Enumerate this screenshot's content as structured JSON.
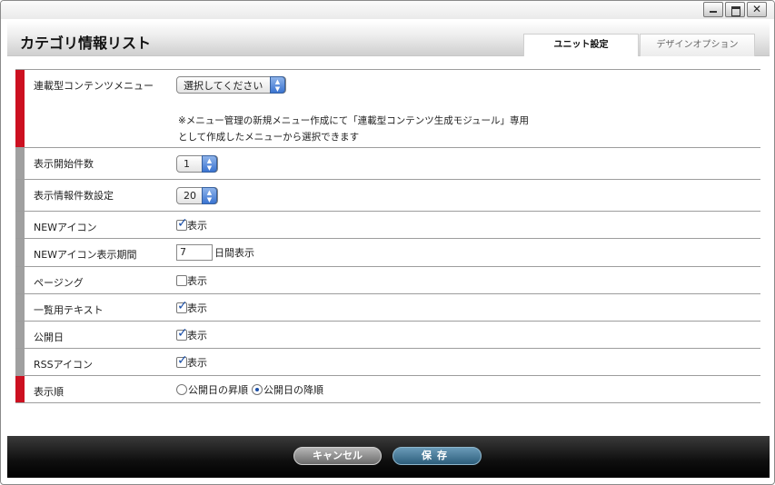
{
  "window": {
    "controls": {
      "close_glyph": "✕"
    }
  },
  "header": {
    "title": "カテゴリ情報リスト",
    "tabs": [
      {
        "label": "ユニット設定",
        "active": true
      },
      {
        "label": "デザインオプション",
        "active": false
      }
    ]
  },
  "rows": [
    {
      "label": "連載型コンテンツメニュー",
      "required": true,
      "control": "select",
      "value": "選択してください",
      "note_line1": "※メニュー管理の新規メニュー作成にて「連載型コンテンツ生成モジュール」専用",
      "note_line2": "として作成したメニューから選択できます"
    },
    {
      "label": "表示開始件数",
      "required": false,
      "control": "select",
      "value": "1"
    },
    {
      "label": "表示情報件数設定",
      "required": false,
      "control": "select",
      "value": "20"
    },
    {
      "label": "NEWアイコン",
      "required": false,
      "control": "checkbox",
      "checked": true,
      "option_label": "表示"
    },
    {
      "label": "NEWアイコン表示期間",
      "required": false,
      "control": "text",
      "value": "7",
      "suffix": "日間表示"
    },
    {
      "label": "ページング",
      "required": false,
      "control": "checkbox",
      "checked": false,
      "option_label": "表示"
    },
    {
      "label": "一覧用テキスト",
      "required": false,
      "control": "checkbox",
      "checked": true,
      "option_label": "表示"
    },
    {
      "label": "公開日",
      "required": false,
      "control": "checkbox",
      "checked": true,
      "option_label": "表示"
    },
    {
      "label": "RSSアイコン",
      "required": false,
      "control": "checkbox",
      "checked": true,
      "option_label": "表示"
    },
    {
      "label": "表示順",
      "required": true,
      "control": "radio",
      "options": [
        {
          "label": "公開日の昇順",
          "selected": false
        },
        {
          "label": "公開日の降順",
          "selected": true
        }
      ]
    }
  ],
  "footer": {
    "cancel_label": "キャンセル",
    "save_label": "保存"
  },
  "colors": {
    "required_bar": "#cc1020",
    "optional_bar": "#a0a0a0",
    "select_arrow": "#3b74d1",
    "save_button": "#2d5e7c"
  }
}
